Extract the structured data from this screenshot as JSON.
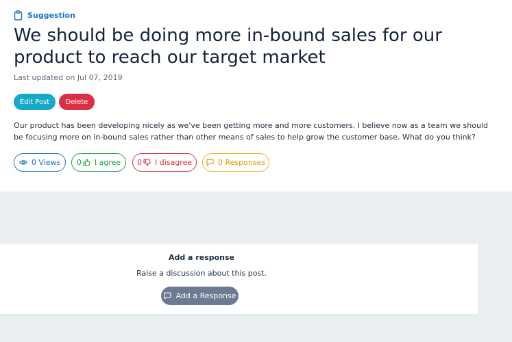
{
  "post": {
    "category": "Suggestion",
    "title": "We should be doing more in-bound sales for our product to reach our target market",
    "updated": "Last updated on Jul 07, 2019",
    "body": "Our product has been developing nicely as we've been getting more and more customers. I believe now as a team we should be focusing more on in-bound sales rather than other means of sales to help grow the customer base. What do you think?"
  },
  "actions": {
    "edit_label": "Edit Post",
    "delete_label": "Delete"
  },
  "stats": {
    "views_label": "0 Views",
    "agree_count": "0",
    "agree_label": "I agree",
    "disagree_count": "0",
    "disagree_label": "I disagree",
    "responses_label": "0 Responses"
  },
  "response_card": {
    "heading": "Add a response",
    "subtext": "Raise a discussion about this post.",
    "button_label": "Add a Response"
  },
  "colors": {
    "accent": "#1a73c9",
    "edit": "#17a9c7",
    "delete": "#dc2f46",
    "agree": "#1f9e47",
    "disagree": "#d93343",
    "responses": "#eeb21f",
    "add_button": "#6c7a92",
    "page_bg": "#e9eef0"
  },
  "icons": {
    "category": "clipboard-icon",
    "views": "eye-icon",
    "agree": "thumbs-up-icon",
    "disagree": "thumbs-down-icon",
    "responses": "chat-bubble-icon"
  }
}
